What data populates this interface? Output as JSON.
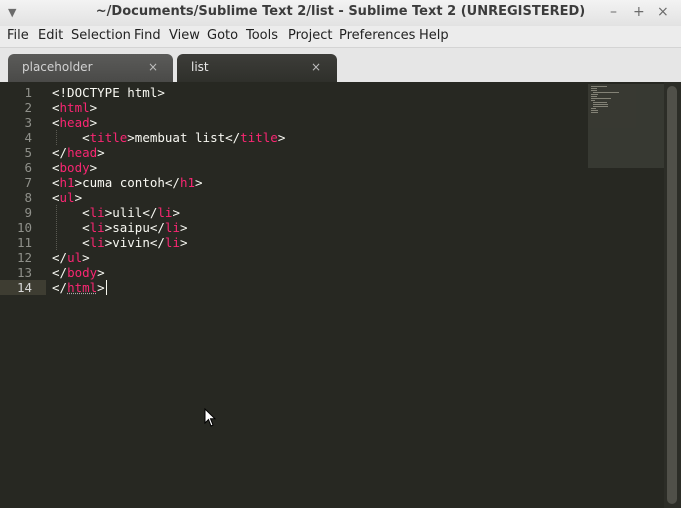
{
  "window": {
    "title": "~/Documents/Sublime Text 2/list - Sublime Text 2 (UNREGISTERED)",
    "minimize_glyph": "–",
    "maximize_glyph": "+",
    "close_glyph": "×",
    "menu_glyph": "▼"
  },
  "menu": [
    "File",
    "Edit",
    "Selection",
    "Find",
    "View",
    "Goto",
    "Tools",
    "Project",
    "Preferences",
    "Help"
  ],
  "tabs": [
    {
      "label": "placeholder",
      "close": "×",
      "active": false
    },
    {
      "label": "list",
      "close": "×",
      "active": true
    }
  ],
  "editor": {
    "line_numbers": [
      "1",
      "2",
      "3",
      "4",
      "5",
      "6",
      "7",
      "8",
      "9",
      "10",
      "11",
      "12",
      "13",
      "14"
    ],
    "current_line": 14,
    "lines": [
      {
        "p0": "<!DOCTYPE html>"
      },
      {
        "p0": "<",
        "t": "html",
        "p1": ">"
      },
      {
        "p0": "<",
        "t": "head",
        "p1": ">"
      },
      {
        "p0": "    <",
        "t": "title",
        "p1": ">membuat list</",
        "t2": "title",
        "p2": ">"
      },
      {
        "p0": "</",
        "t": "head",
        "p1": ">"
      },
      {
        "p0": "<",
        "t": "body",
        "p1": ">"
      },
      {
        "p0": "<",
        "t": "h1",
        "p1": ">cuma contoh</",
        "t2": "h1",
        "p2": ">"
      },
      {
        "p0": "<",
        "t": "ul",
        "p1": ">"
      },
      {
        "p0": "    <",
        "t": "li",
        "p1": ">ulil</",
        "t2": "li",
        "p2": ">"
      },
      {
        "p0": "    <",
        "t": "li",
        "p1": ">saipu</",
        "t2": "li",
        "p2": ">"
      },
      {
        "p0": "    <",
        "t": "li",
        "p1": ">vivin</",
        "t2": "li",
        "p2": ">"
      },
      {
        "p0": "</",
        "t": "ul",
        "p1": ">"
      },
      {
        "p0": "</",
        "t": "body",
        "p1": ">"
      },
      {
        "p0": "</",
        "t": "html",
        "p1": ">"
      }
    ]
  },
  "colors": {
    "background": "#272822",
    "text": "#f8f8f2",
    "tag": "#f92672",
    "gutter_text": "#8f908a"
  }
}
